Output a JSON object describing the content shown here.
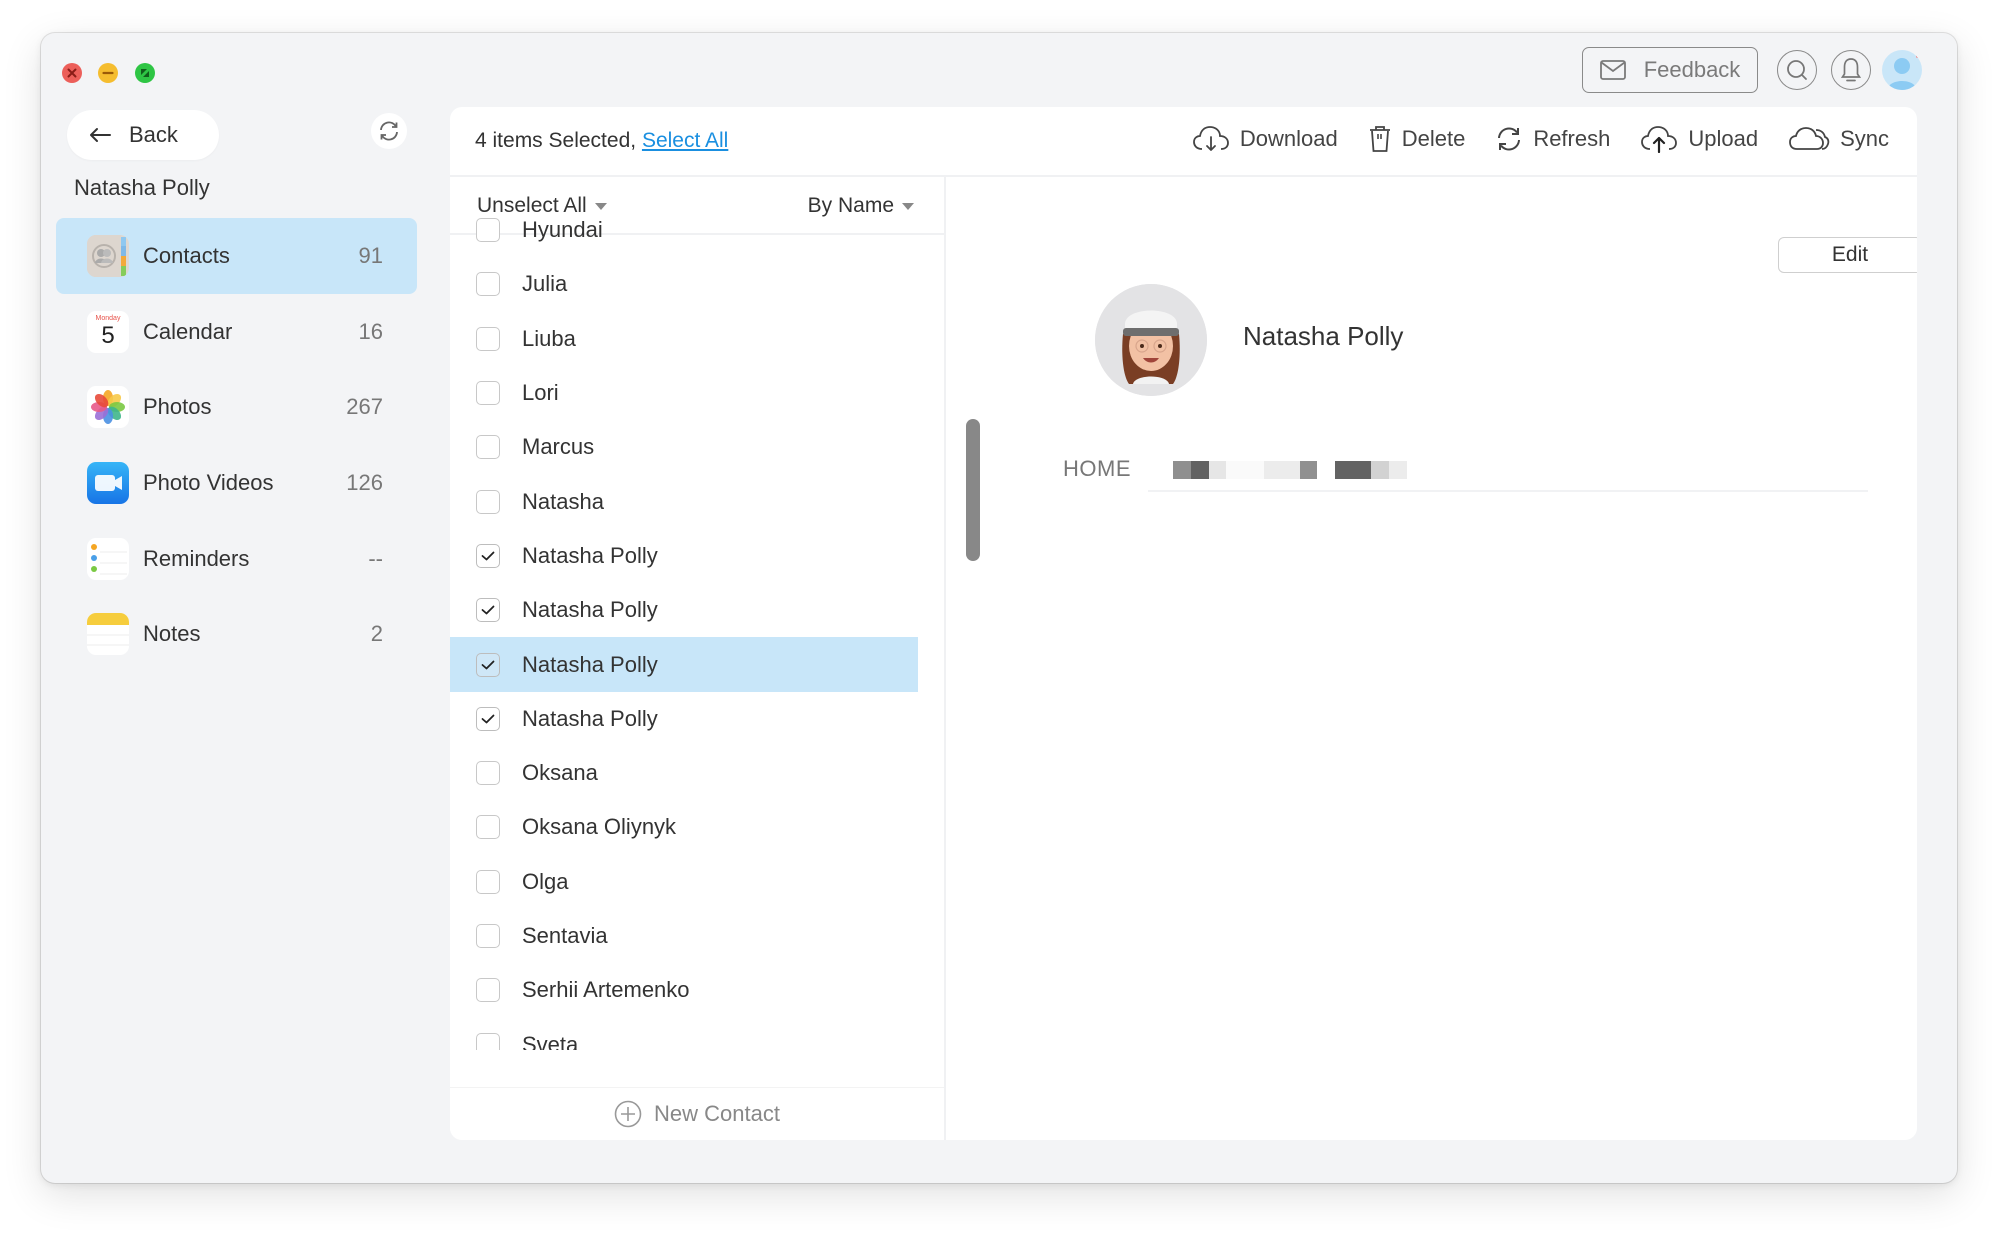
{
  "window": {
    "controls": [
      "close",
      "minimize",
      "maximize"
    ]
  },
  "header": {
    "feedback_label": "Feedback",
    "search_icon": "search-icon",
    "bell_icon": "bell-icon",
    "avatar_icon": "user-avatar-icon"
  },
  "sidebar": {
    "back_label": "Back",
    "device_name": "Natasha Polly",
    "items": [
      {
        "label": "Contacts",
        "count": "91",
        "icon": "contacts-icon",
        "active": true
      },
      {
        "label": "Calendar",
        "count": "16",
        "icon": "calendar-icon",
        "active": false,
        "icon_day": "Monday",
        "icon_date": "5"
      },
      {
        "label": "Photos",
        "count": "267",
        "icon": "photos-icon",
        "active": false
      },
      {
        "label": "Photo Videos",
        "count": "126",
        "icon": "video-icon",
        "active": false
      },
      {
        "label": "Reminders",
        "count": "--",
        "icon": "reminders-icon",
        "active": false
      },
      {
        "label": "Notes",
        "count": "2",
        "icon": "notes-icon",
        "active": false
      }
    ]
  },
  "toolbar": {
    "selection_text": "4 items Selected,",
    "select_all_label": "Select All",
    "actions": [
      {
        "label": "Download",
        "icon": "cloud-download-icon"
      },
      {
        "label": "Delete",
        "icon": "trash-icon"
      },
      {
        "label": "Refresh",
        "icon": "refresh-icon"
      },
      {
        "label": "Upload",
        "icon": "cloud-upload-icon"
      },
      {
        "label": "Sync",
        "icon": "cloud-sync-icon"
      }
    ]
  },
  "list": {
    "unselect_label": "Unselect All",
    "sort_label": "By Name",
    "contacts": [
      {
        "name": "Hyundai",
        "checked": false,
        "selected": false
      },
      {
        "name": "Julia",
        "checked": false,
        "selected": false
      },
      {
        "name": "Liuba",
        "checked": false,
        "selected": false
      },
      {
        "name": "Lori",
        "checked": false,
        "selected": false
      },
      {
        "name": "Marcus",
        "checked": false,
        "selected": false
      },
      {
        "name": "Natasha",
        "checked": false,
        "selected": false
      },
      {
        "name": "Natasha Polly",
        "checked": true,
        "selected": false
      },
      {
        "name": "Natasha Polly",
        "checked": true,
        "selected": false
      },
      {
        "name": "Natasha Polly",
        "checked": true,
        "selected": true
      },
      {
        "name": "Natasha Polly",
        "checked": true,
        "selected": false
      },
      {
        "name": "Oksana",
        "checked": false,
        "selected": false
      },
      {
        "name": "Oksana Oliynyk",
        "checked": false,
        "selected": false
      },
      {
        "name": "Olga",
        "checked": false,
        "selected": false
      },
      {
        "name": "Sentavia",
        "checked": false,
        "selected": false
      },
      {
        "name": "Serhii Artemenko",
        "checked": false,
        "selected": false
      },
      {
        "name": "Sveta",
        "checked": false,
        "selected": false
      }
    ],
    "new_contact_label": "New Contact"
  },
  "detail": {
    "edit_label": "Edit",
    "name": "Natasha Polly",
    "fields": [
      {
        "label": "HOME",
        "value_redacted": true
      }
    ]
  },
  "colors": {
    "accent_link": "#1a8fe0",
    "selection_bg": "#c8e6f9",
    "window_bg": "#f3f4f6"
  }
}
